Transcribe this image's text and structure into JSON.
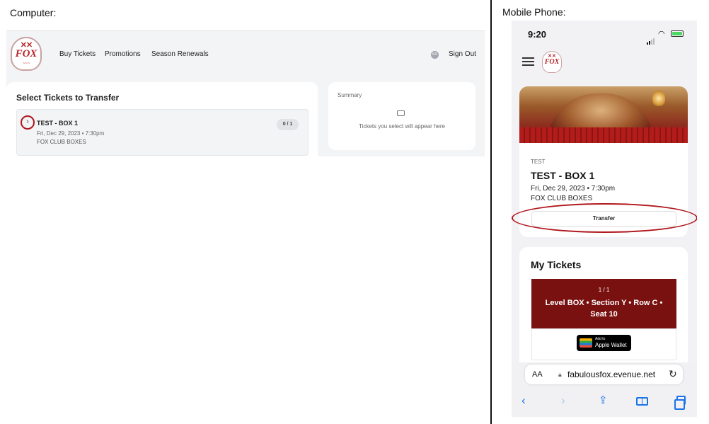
{
  "labels": {
    "computer": "Computer:",
    "mobile": "Mobile Phone:"
  },
  "desktop": {
    "logo_text": "FOX",
    "nav": [
      "Buy Tickets",
      "Promotions",
      "Season Renewals"
    ],
    "avatar_initials": "KR",
    "sign_out": "Sign Out",
    "select_title": "Select Tickets to Transfer",
    "event": {
      "name": "TEST - BOX 1",
      "date": "Fri, Dec 29, 2023 • 7:30pm",
      "venue": "FOX CLUB BOXES",
      "count": "0 / 1"
    },
    "summary": {
      "title": "Summary",
      "empty_text": "Tickets you select will appear here"
    }
  },
  "phone": {
    "time": "9:20",
    "logo_text": "FOX",
    "event": {
      "tag": "TEST",
      "name": "TEST - BOX 1",
      "date": "Fri, Dec 29, 2023 • 7:30pm",
      "venue": "FOX CLUB BOXES",
      "transfer_label": "Transfer"
    },
    "my_tickets": {
      "title": "My Tickets",
      "count": "1 / 1",
      "seat": "Level BOX • Section Y • Row C • Seat 10",
      "wallet_small": "Add to",
      "wallet_big": "Apple Wallet"
    },
    "browser": {
      "aa": "AA",
      "url": "fabulousfox.evenue.net"
    }
  },
  "colors": {
    "highlight": "#b0171c",
    "ticket_bg": "#7a1111",
    "ios_blue": "#1a73e8"
  }
}
